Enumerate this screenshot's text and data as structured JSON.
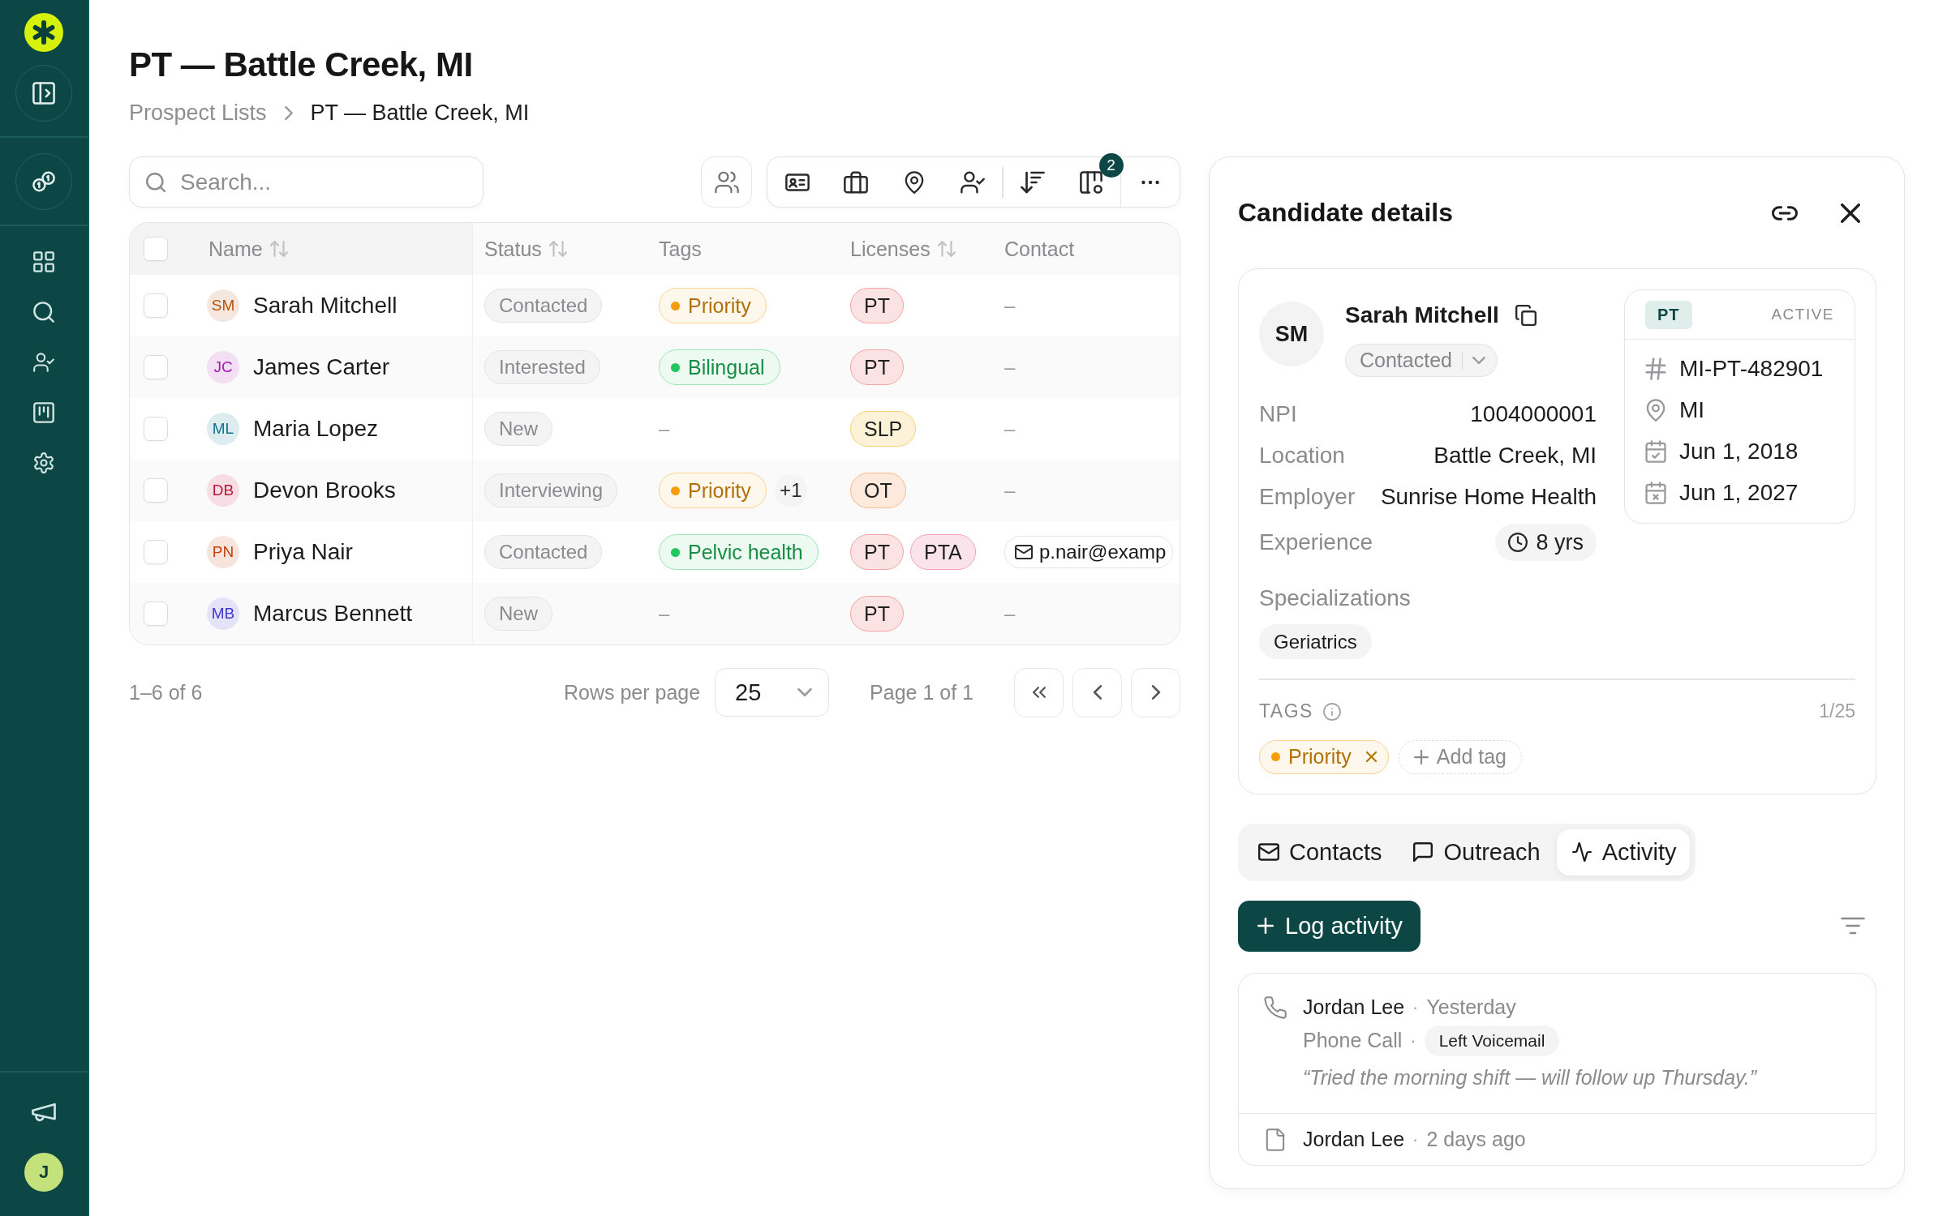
{
  "sidebar": {
    "user_initial": "J"
  },
  "header": {
    "title": "PT — Battle Creek, MI",
    "breadcrumb": [
      {
        "label": "Prospect Lists",
        "current": false
      },
      {
        "label": "PT — Battle Creek, MI",
        "current": true
      }
    ]
  },
  "toolbar": {
    "search": {
      "placeholder": "Search..."
    },
    "columns_badge": "2"
  },
  "table": {
    "select_all": {
      "checked": false
    },
    "columns": [
      {
        "label": "Name",
        "sortable": true
      },
      {
        "label": "Status",
        "sortable": true
      },
      {
        "label": "Tags",
        "sortable": false
      },
      {
        "label": "Licenses",
        "sortable": true
      },
      {
        "label": "Contact",
        "sortable": false
      }
    ],
    "rows": [
      {
        "checked": false,
        "avatar": {
          "initials": "SM",
          "color": "#b45309"
        },
        "name": "Sarah Mitchell",
        "status": "Contacted",
        "tags": {
          "kind": "list",
          "items": [
            {
              "label": "Priority",
              "color": "#f59e0b"
            }
          ]
        },
        "licenses": [
          {
            "label": "PT",
            "color": "#f5a3a3"
          }
        ],
        "contact": {
          "kind": "none",
          "text": "–"
        }
      },
      {
        "checked": false,
        "avatar": {
          "initials": "JC",
          "color": "#a21caf"
        },
        "name": "James Carter",
        "status": "Interested",
        "tags": {
          "kind": "list",
          "items": [
            {
              "label": "Bilingual",
              "color": "#22c55e"
            }
          ]
        },
        "licenses": [
          {
            "label": "PT",
            "color": "#f5a3a3"
          }
        ],
        "contact": {
          "kind": "none",
          "text": "–"
        }
      },
      {
        "checked": false,
        "avatar": {
          "initials": "ML",
          "color": "#0e7490"
        },
        "name": "Maria Lopez",
        "status": "New",
        "tags": {
          "kind": "none",
          "text": "–"
        },
        "licenses": [
          {
            "label": "SLP",
            "color": "#f5d27a"
          }
        ],
        "contact": {
          "kind": "none",
          "text": "–"
        }
      },
      {
        "checked": false,
        "avatar": {
          "initials": "DB",
          "color": "#be123c"
        },
        "name": "Devon Brooks",
        "status": "Interviewing",
        "tags": {
          "kind": "list",
          "items": [
            {
              "label": "Priority",
              "color": "#f59e0b"
            }
          ],
          "more": "+1"
        },
        "licenses": [
          {
            "label": "OT",
            "color": "#f8b98a"
          }
        ],
        "contact": {
          "kind": "none",
          "text": "–"
        }
      },
      {
        "checked": false,
        "avatar": {
          "initials": "PN",
          "color": "#c2410c"
        },
        "name": "Priya Nair",
        "status": "Contacted",
        "tags": {
          "kind": "list",
          "items": [
            {
              "label": "Pelvic health",
              "color": "#22c55e"
            }
          ]
        },
        "licenses": [
          {
            "label": "PT",
            "color": "#f5a3a3"
          },
          {
            "label": "PTA",
            "color": "#f3a0c0"
          }
        ],
        "contact": {
          "kind": "email",
          "text": "p.nair@examp"
        }
      },
      {
        "checked": false,
        "avatar": {
          "initials": "MB",
          "color": "#4338ca"
        },
        "name": "Marcus Bennett",
        "status": "New",
        "tags": {
          "kind": "none",
          "text": "–"
        },
        "licenses": [
          {
            "label": "PT",
            "color": "#f5a3a3"
          }
        ],
        "contact": {
          "kind": "none",
          "text": "–"
        }
      }
    ]
  },
  "pagination": {
    "range": "1–6 of 6",
    "rows_per_page_label": "Rows per page",
    "rows_per_page": "25",
    "page": "Page 1 of 1"
  },
  "detail": {
    "title": "Candidate details",
    "candidate": {
      "initials": "SM",
      "name": "Sarah Mitchell",
      "status": "Contacted"
    },
    "fields": [
      {
        "label": "NPI",
        "value": "1004000001",
        "kind": "text"
      },
      {
        "label": "Location",
        "value": "Battle Creek, MI",
        "kind": "text"
      },
      {
        "label": "Employer",
        "value": "Sunrise Home Health",
        "kind": "text"
      },
      {
        "label": "Experience",
        "value": "8 yrs",
        "kind": "duration"
      }
    ],
    "license": {
      "type": "PT",
      "status": "ACTIVE",
      "rows": [
        {
          "kind": "number",
          "value": "MI-PT-482901"
        },
        {
          "kind": "state",
          "value": "MI"
        },
        {
          "kind": "issued",
          "value": "Jun 1, 2018"
        },
        {
          "kind": "expires",
          "value": "Jun 1, 2027"
        }
      ]
    },
    "specializations": {
      "label": "Specializations",
      "items": [
        "Geriatrics"
      ]
    },
    "tags": {
      "label": "TAGS",
      "count": "1/25",
      "items": [
        {
          "label": "Priority",
          "color": "#f59e0b"
        }
      ],
      "add_label": "Add tag"
    },
    "tabs": [
      {
        "label": "Contacts",
        "kind": "contacts",
        "selected": false
      },
      {
        "label": "Outreach",
        "kind": "outreach",
        "selected": false
      },
      {
        "label": "Activity",
        "kind": "activity",
        "selected": true
      }
    ],
    "log_button": "Log activity",
    "separator": "·",
    "activities": [
      {
        "kind": "call",
        "author": "Jordan Lee",
        "time": "Yesterday",
        "type": "Phone Call",
        "outcome": "Left Voicemail",
        "note": "“Tried the morning shift — will follow up Thursday.”"
      },
      {
        "kind": "note",
        "author": "Jordan Lee",
        "time": "2 days ago"
      }
    ]
  }
}
